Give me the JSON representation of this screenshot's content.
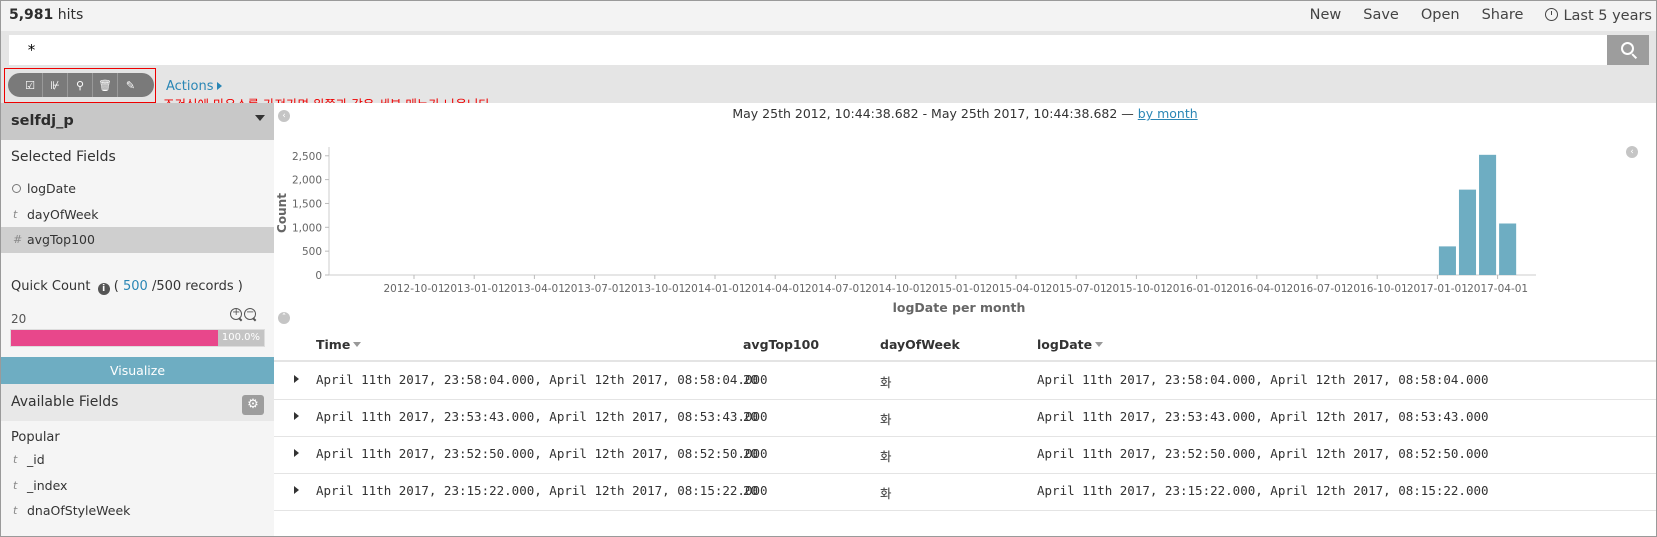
{
  "header": {
    "hits_count": "5,981",
    "hits_label": "hits",
    "menu": [
      "New",
      "Save",
      "Open",
      "Share"
    ],
    "time_picker": "Last 5 years"
  },
  "search": {
    "query": "*"
  },
  "toolbar": {
    "buttons": [
      "check-square-icon",
      "filter-toggle-icon",
      "zoom-icon",
      "trash-icon",
      "edit-icon"
    ],
    "actions_label": "Actions",
    "annotation": "조건식에 마우스를 가져가면 왼쪽과 같은 세부 메뉴가 나옵니다."
  },
  "sidebar": {
    "index_name": "selfdj_p",
    "selected_fields_title": "Selected Fields",
    "selected_fields": [
      {
        "type": "clock",
        "name": "logDate"
      },
      {
        "type": "t",
        "name": "dayOfWeek"
      },
      {
        "type": "#",
        "name": "avgTop100"
      }
    ],
    "quick_count": {
      "label": "Quick Count",
      "open_paren": "(",
      "records_shown": "500",
      "records_total": "/500 records )",
      "value": "20",
      "percent_label": "100.0%",
      "percent": 100
    },
    "visualize_label": "Visualize",
    "available_fields_title": "Available Fields",
    "popular_title": "Popular",
    "available_fields": [
      {
        "type": "t",
        "name": "_id"
      },
      {
        "type": "t",
        "name": "_index"
      },
      {
        "type": "t",
        "name": "dnaOfStyleWeek"
      }
    ]
  },
  "chart_range": {
    "text": "May 25th 2012, 10:44:38.682 - May 25th 2017, 10:44:38.682 —",
    "interval_link": "by month"
  },
  "chart_data": {
    "type": "bar",
    "xlabel": "logDate per month",
    "ylabel": "Count",
    "y_ticks": [
      "0",
      "500",
      "1,000",
      "1,500",
      "2,000",
      "2,500"
    ],
    "ylim": [
      0,
      2600
    ],
    "x_ticks": [
      "2012-10-01",
      "2013-01-01",
      "2013-04-01",
      "2013-07-01",
      "2013-10-01",
      "2014-01-01",
      "2014-04-01",
      "2014-07-01",
      "2014-10-01",
      "2015-01-01",
      "2015-04-01",
      "2015-07-01",
      "2015-10-01",
      "2016-01-01",
      "2016-04-01",
      "2016-07-01",
      "2016-10-01",
      "2017-01-01",
      "2017-04-01"
    ],
    "categories": [
      "2017-01",
      "2017-02",
      "2017-03",
      "2017-04"
    ],
    "values": [
      600,
      1790,
      2520,
      1080
    ],
    "color": "#6eadc2"
  },
  "table": {
    "columns": [
      "Time",
      "avgTop100",
      "dayOfWeek",
      "logDate"
    ],
    "rows": [
      {
        "time": "April 11th 2017, 23:58:04.000, April 12th 2017, 08:58:04.000",
        "avg": "20",
        "day": "화",
        "logdate": "April 11th 2017, 23:58:04.000, April 12th 2017, 08:58:04.000"
      },
      {
        "time": "April 11th 2017, 23:53:43.000, April 12th 2017, 08:53:43.000",
        "avg": "20",
        "day": "화",
        "logdate": "April 11th 2017, 23:53:43.000, April 12th 2017, 08:53:43.000"
      },
      {
        "time": "April 11th 2017, 23:52:50.000, April 12th 2017, 08:52:50.000",
        "avg": "20",
        "day": "화",
        "logdate": "April 11th 2017, 23:52:50.000, April 12th 2017, 08:52:50.000"
      },
      {
        "time": "April 11th 2017, 23:15:22.000, April 12th 2017, 08:15:22.000",
        "avg": "20",
        "day": "화",
        "logdate": "April 11th 2017, 23:15:22.000, April 12th 2017, 08:15:22.000"
      }
    ]
  }
}
